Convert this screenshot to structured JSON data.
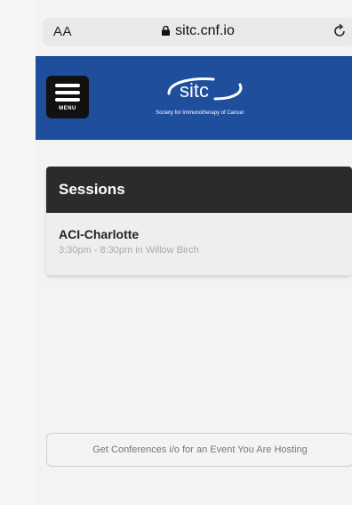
{
  "browser": {
    "text_size_label": "AA",
    "url": "sitc.cnf.io"
  },
  "header": {
    "menu_label": "MENU",
    "logo_text": "sitc",
    "logo_tagline": "Society for Immunotherapy of Cancer",
    "brand_color": "#1e4e9c"
  },
  "sessions_card": {
    "title": "Sessions",
    "items": [
      {
        "name": "ACI-Charlotte",
        "detail": "3:30pm - 8:30pm in Willow Birch"
      }
    ]
  },
  "footer": {
    "host_link": "Get Conferences i/o for an Event You Are Hosting"
  }
}
